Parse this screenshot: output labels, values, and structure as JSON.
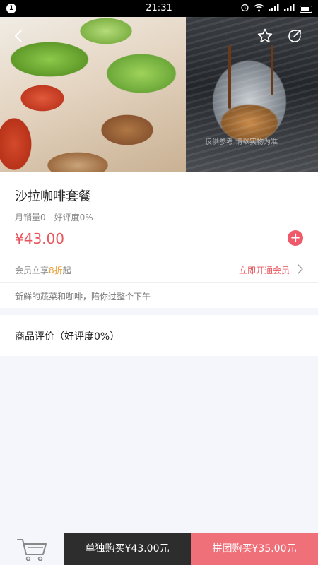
{
  "status_bar": {
    "notification_count": "1",
    "time": "21:31",
    "icons": [
      "alarm-icon",
      "wifi-icon",
      "signal-icon",
      "signal-icon",
      "battery-icon"
    ]
  },
  "hero": {
    "watermark": "仅供参考 请以实物为准"
  },
  "product": {
    "title": "沙拉咖啡套餐",
    "monthly_sales": "月销量0",
    "rating": "好评度0%",
    "price": "¥43.00"
  },
  "member": {
    "prefix": "会员立享",
    "discount": "8折",
    "suffix": "起",
    "cta": "立即开通会员"
  },
  "description": "新鲜的蔬菜和咖啡，陪你过整个下午",
  "reviews": {
    "title": "商品评价（好评度0%）"
  },
  "bottom_bar": {
    "solo_buy": "单独购买¥43.00元",
    "group_buy": "拼团购买¥35.00元"
  },
  "colors": {
    "accent": "#e8545c",
    "group_button": "#f0707a",
    "solo_button": "#2d2d2d",
    "discount_highlight": "#e8a03a"
  }
}
